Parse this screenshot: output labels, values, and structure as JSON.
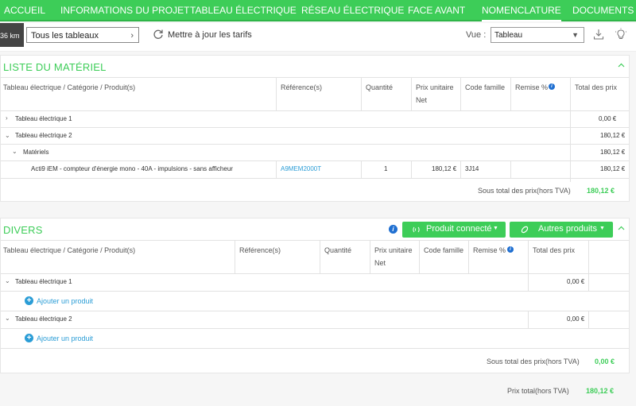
{
  "nav": {
    "tabs": [
      "ACCUEIL",
      "INFORMATIONS DU PROJET",
      "TABLEAU ÉLECTRIQUE",
      "RÉSEAU ÉLECTRIQUE",
      "FACE AVANT",
      "NOMENCLATURE",
      "DOCUMENTS"
    ],
    "active": "NOMENCLATURE"
  },
  "toolbar": {
    "badge": "36 km",
    "tableau_select": "Tous les tableaux",
    "refresh_label": "Mettre à jour les tarifs",
    "vue_label": "Vue :",
    "vue_value": "Tableau"
  },
  "materiel": {
    "title": "LISTE DU MATÉRIEL",
    "headers": {
      "col1": "Tableau électrique / Catégorie / Produit(s)",
      "ref": "Référence(s)",
      "qty": "Quantité",
      "price1": "Prix unitaire",
      "price2": "Net",
      "family": "Code famille",
      "discount": "Remise %",
      "total": "Total des prix"
    },
    "rows": [
      {
        "label": "Tableau électrique 1",
        "total": "0,00 €"
      },
      {
        "label": "Tableau électrique 2",
        "total": "180,12 €"
      },
      {
        "label": "Matériels",
        "total": "180,12 €"
      }
    ],
    "product": {
      "name": "Acti9 iEM - compteur d'énergie mono - 40A - impulsions - sans afficheur",
      "ref": "A9MEM2000T",
      "qty": "1",
      "unit_price": "180,12 €",
      "family": "3J14",
      "total": "180,12 €"
    },
    "subtotal_label": "Sous total des prix(hors TVA)",
    "subtotal_value": "180,12 €"
  },
  "divers": {
    "title": "DIVERS",
    "btn_connected": "Produit connecté",
    "btn_other": "Autres produits",
    "headers": {
      "col1": "Tableau électrique / Catégorie / Produit(s)",
      "ref": "Référence(s)",
      "qty": "Quantité",
      "price1": "Prix unitaire",
      "price2": "Net",
      "family": "Code famille",
      "discount": "Remise %",
      "total": "Total des prix"
    },
    "rows": [
      {
        "label": "Tableau électrique 1",
        "total": "0,00 €",
        "add": "Ajouter un produit"
      },
      {
        "label": "Tableau électrique 2",
        "total": "0,00 €",
        "add": "Ajouter un produit"
      }
    ],
    "subtotal_label": "Sous total des prix(hors TVA)",
    "subtotal_value": "0,00 €"
  },
  "total": {
    "label": "Prix total(hors TVA)",
    "value": "180,12 €"
  },
  "colors": {
    "accent": "#3dcd58",
    "link": "#2b9dd6"
  }
}
